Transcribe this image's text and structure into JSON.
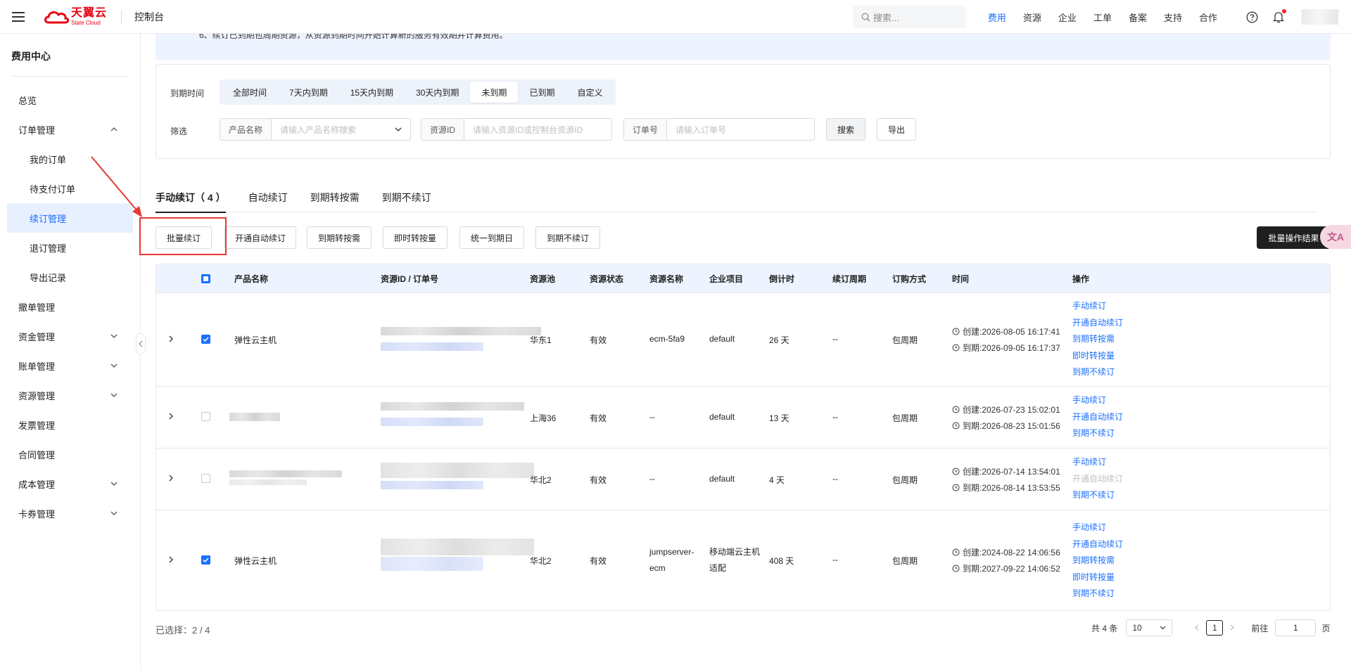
{
  "header": {
    "logo_cn": "天翼云",
    "logo_en": "State Cloud",
    "console": "控制台",
    "search_placeholder": "搜索...",
    "nav": [
      "费用",
      "资源",
      "企业",
      "工单",
      "备案",
      "支持",
      "合作"
    ],
    "active_nav": "费用",
    "accent": "#1a6fff",
    "brand_red": "#e60012"
  },
  "sidebar": {
    "title": "费用中心",
    "items": [
      {
        "label": "总览"
      },
      {
        "label": "订单管理"
      },
      {
        "label": "我的订单"
      },
      {
        "label": "待支付订单"
      },
      {
        "label": "续订管理"
      },
      {
        "label": "退订管理"
      },
      {
        "label": "导出记录"
      },
      {
        "label": "撤单管理"
      },
      {
        "label": "资金管理"
      },
      {
        "label": "账单管理"
      },
      {
        "label": "资源管理"
      },
      {
        "label": "发票管理"
      },
      {
        "label": "合同管理"
      },
      {
        "label": "成本管理"
      },
      {
        "label": "卡券管理"
      }
    ]
  },
  "notice": "6、续订已到期包周期资源，从资源到期时间开始计算新的服务有效期并计算费用。",
  "filters": {
    "expire_label": "到期时间",
    "expire_options": [
      "全部时间",
      "7天内到期",
      "15天内到期",
      "30天内到期",
      "未到期",
      "已到期",
      "自定义"
    ],
    "expire_selected": "未到期",
    "filter_label": "筛选",
    "product_label": "产品名称",
    "product_placeholder": "请输入产品名称搜索",
    "resource_label": "资源ID",
    "resource_placeholder": "请输入资源ID或控制台资源ID",
    "order_label": "订单号",
    "order_placeholder": "请输入订单号",
    "search_btn": "搜索",
    "export_btn": "导出"
  },
  "tabs": [
    "手动续订（ 4 ）",
    "自动续订",
    "到期转按需",
    "到期不续订"
  ],
  "actions": {
    "batch_renew": "批量续订",
    "open_auto": "开通自动续订",
    "to_ondemand": "到期转按需",
    "instant_ondemand": "即时转按量",
    "unify_date": "统一到期日",
    "no_renew": "到期不续订",
    "batch_result": "批量操作结果"
  },
  "translate_fab": "文A",
  "table": {
    "headers": [
      "产品名称",
      "资源ID / 订单号",
      "资源池",
      "资源状态",
      "资源名称",
      "企业项目",
      "倒计时",
      "续订周期",
      "订购方式",
      "时间",
      "操作"
    ],
    "rows": [
      {
        "checked": true,
        "product": "弹性云主机",
        "pool": "华东1",
        "status": "有效",
        "res_name": "ecm-5fa9",
        "project": "default",
        "countdown": "26 天",
        "period": "--",
        "method": "包周期",
        "created": "创建:2026-08-05 16:17:41",
        "expire": "到期:2026-09-05 16:17:37",
        "ops": [
          {
            "t": "手动续订"
          },
          {
            "t": "开通自动续订"
          },
          {
            "t": "到期转按需"
          },
          {
            "t": "即时转按量"
          },
          {
            "t": "到期不续订"
          }
        ]
      },
      {
        "checked": false,
        "product": "",
        "pool": "上海36",
        "status": "有效",
        "res_name": "--",
        "project": "default",
        "countdown": "13 天",
        "period": "--",
        "method": "包周期",
        "created": "创建:2026-07-23 15:02:01",
        "expire": "到期:2026-08-23 15:01:56",
        "ops": [
          {
            "t": "手动续订"
          },
          {
            "t": "开通自动续订"
          },
          {
            "t": "到期不续订"
          }
        ]
      },
      {
        "checked": false,
        "product": "",
        "pool": "华北2",
        "status": "有效",
        "res_name": "--",
        "project": "default",
        "countdown": "4 天",
        "period": "--",
        "method": "包周期",
        "created": "创建:2026-07-14 13:54:01",
        "expire": "到期:2026-08-14 13:53:55",
        "ops": [
          {
            "t": "手动续订"
          },
          {
            "t": "开通自动续订",
            "disabled": true
          },
          {
            "t": "到期不续订"
          }
        ]
      },
      {
        "checked": true,
        "product": "弹性云主机",
        "pool": "华北2",
        "status": "有效",
        "res_name": "jumpserver-ecm",
        "project": "移动端云主机适配",
        "countdown": "408 天",
        "period": "--",
        "method": "包周期",
        "created": "创建:2024-08-22 14:06:56",
        "expire": "到期:2027-09-22 14:06:52",
        "ops": [
          {
            "t": "手动续订"
          },
          {
            "t": "开通自动续订"
          },
          {
            "t": "到期转按需"
          },
          {
            "t": "即时转按量"
          },
          {
            "t": "到期不续订"
          }
        ]
      }
    ]
  },
  "footer": {
    "selected": "已选择：2 / 4",
    "total": "共 4 条",
    "page_size": "10",
    "current_page": "1",
    "goto_label": "前往",
    "goto_value": "1",
    "page_suffix": "页"
  }
}
